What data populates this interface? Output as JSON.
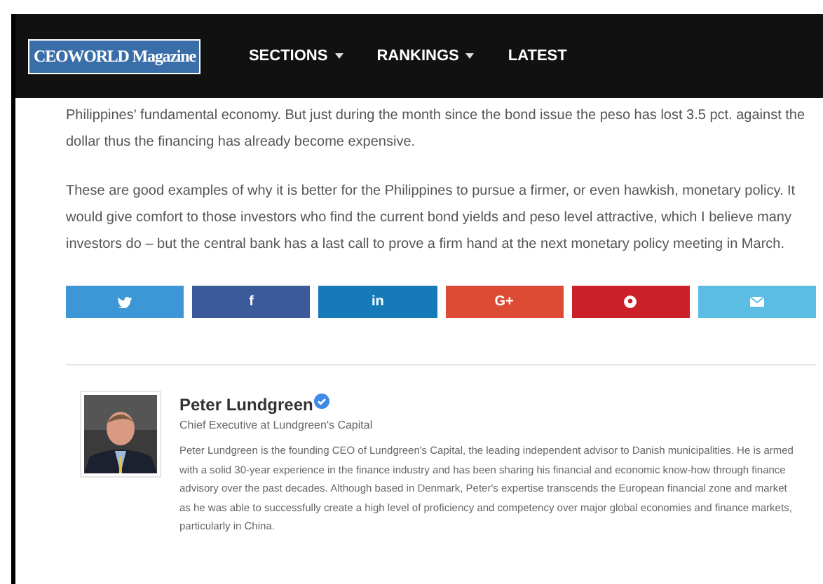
{
  "navbar": {
    "logo": "CEOWORLD Magazine",
    "items": [
      {
        "label": "SECTIONS",
        "dropdown": true
      },
      {
        "label": "RANKINGS",
        "dropdown": true
      },
      {
        "label": "LATEST",
        "dropdown": false
      }
    ]
  },
  "article": {
    "paragraphs": [
      "Philippines' fundamental economy. But just during the month since the bond issue the peso has lost 3.5 pct. against the dollar thus the financing has already become expensive.",
      "These are good examples of why it is better for the Philippines to pursue a firmer, or even hawkish, monetary policy. It would give comfort to those investors who find the current bond yields and peso level attractive, which I believe many investors do – but the central bank has a last call to prove a firm hand at the next monetary policy meeting in March."
    ]
  },
  "share_buttons": [
    {
      "kind": "twitter",
      "color": "#3d97d6"
    },
    {
      "kind": "text",
      "label": "f",
      "color": "#3b5a9a"
    },
    {
      "kind": "text",
      "label": "in",
      "color": "#1679b8"
    },
    {
      "kind": "text",
      "label": "G+",
      "color": "#dd4b35"
    },
    {
      "kind": "pinterest",
      "color": "#cb2027"
    },
    {
      "kind": "email",
      "color": "#5bbde3"
    }
  ],
  "author": {
    "name": "Peter Lundgreen",
    "verified": true,
    "title": "Chief Executive at Lundgreen's Capital",
    "bio": "Peter Lundgreen is the founding CEO of Lundgreen's Capital, the leading independent advisor to Danish municipalities. He is armed with a solid 30-year experience in the finance industry and has been sharing his financial and economic know-how through finance advisory over the past decades. Although based in Denmark, Peter's expertise transcends the European financial zone and market as he was able to successfully create a high level of proficiency and competency over major global economies and finance markets, particularly in China."
  }
}
